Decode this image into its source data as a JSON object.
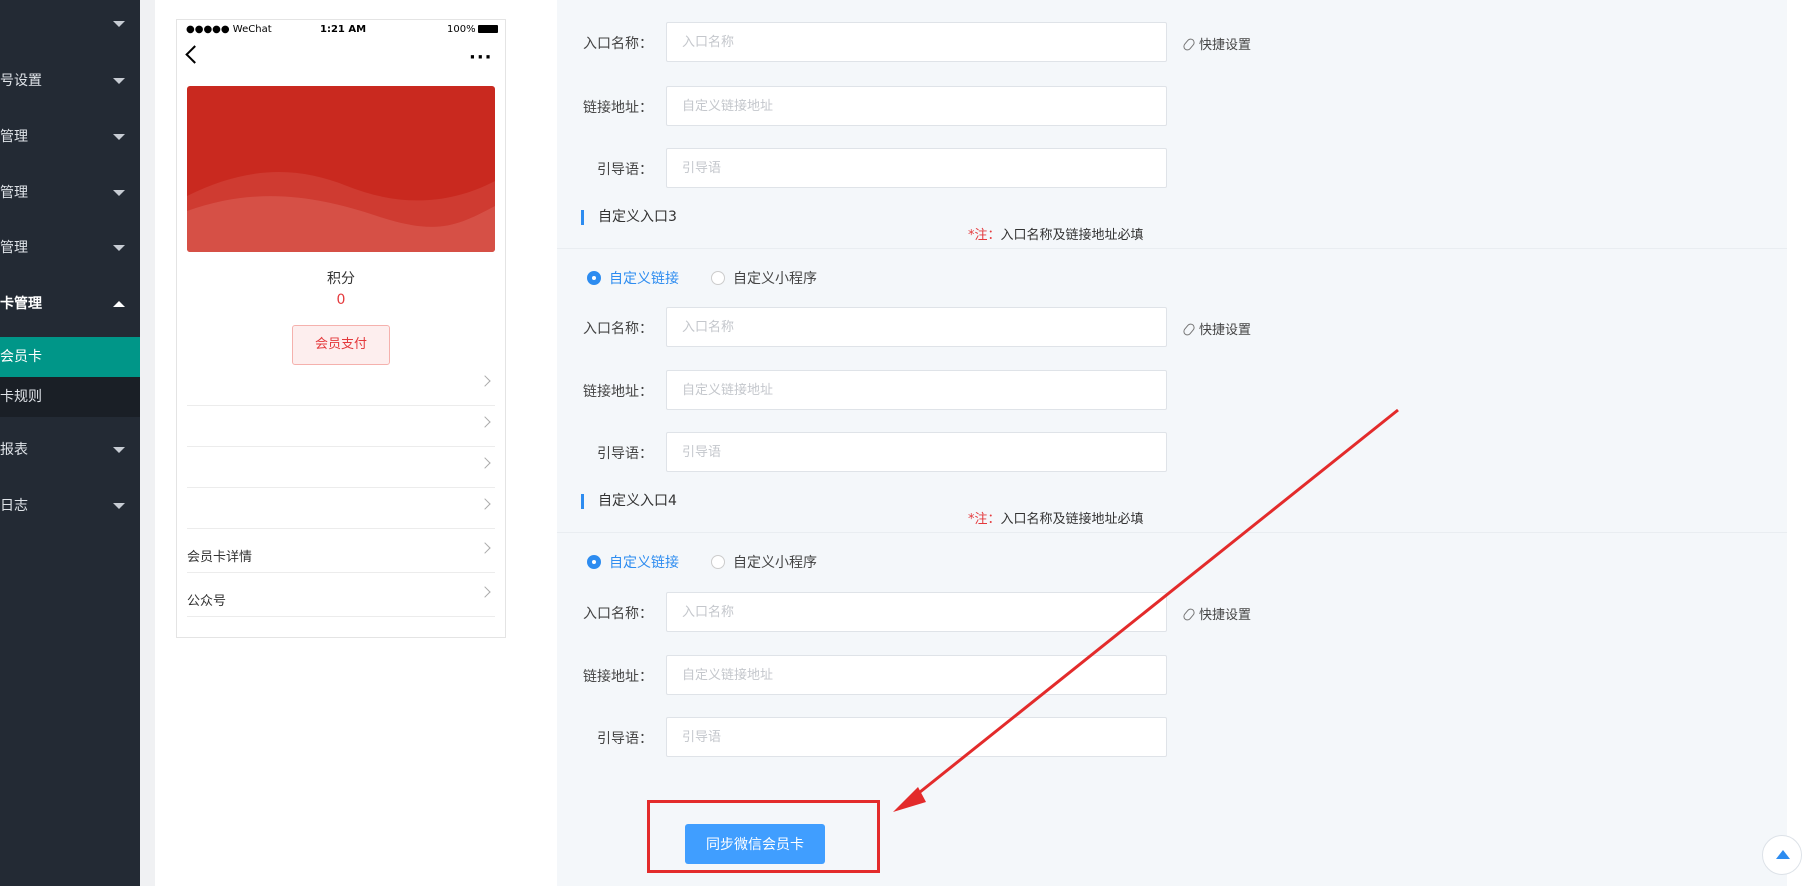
{
  "sidebar": {
    "items": [
      {
        "label": ""
      },
      {
        "label": "号设置"
      },
      {
        "label": "管理"
      },
      {
        "label": "管理"
      },
      {
        "label": "管理"
      },
      {
        "label": "卡管理"
      },
      {
        "label": "报表"
      },
      {
        "label": "日志"
      }
    ],
    "sub_items": [
      {
        "label": "会员卡"
      },
      {
        "label": "卡规则"
      }
    ]
  },
  "phone": {
    "status_signal": "●●●●● WeChat",
    "status_time": "1:21 AM",
    "status_battery": "100%",
    "points_label": "积分",
    "points_value": "0",
    "pay_button": "会员支付",
    "rows": [
      {
        "label": ""
      },
      {
        "label": ""
      },
      {
        "label": ""
      },
      {
        "label": ""
      },
      {
        "label": "会员卡详情"
      },
      {
        "label": "公众号"
      }
    ]
  },
  "form": {
    "labels": {
      "entry_name": "入口名称：",
      "link_url": "链接地址：",
      "guide": "引导语："
    },
    "placeholders": {
      "entry_name": "入口名称",
      "link_url": "自定义链接地址",
      "guide": "引导语"
    },
    "quick_settings": "快捷设置",
    "radio_link": "自定义链接",
    "radio_miniprogram": "自定义小程序",
    "note_prefix": "*注：",
    "note_text": "入口名称及链接地址必填",
    "sections": [
      {
        "title": "自定义入口3"
      },
      {
        "title": "自定义入口4"
      }
    ],
    "sync_button": "同步微信会员卡"
  },
  "colors": {
    "sidebar_bg": "#232a34",
    "sidebar_active": "#009688",
    "card_red": "#c9291f",
    "accent_blue": "#2d8cf0",
    "button_blue": "#409eff",
    "annotation_red": "#e32b2b"
  }
}
